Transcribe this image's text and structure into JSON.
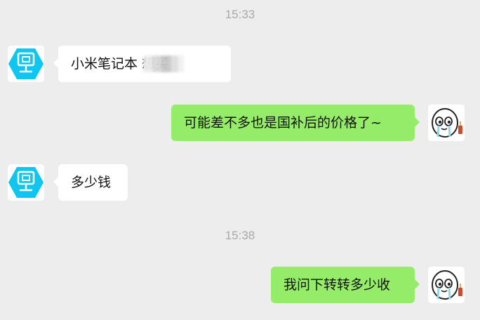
{
  "chat": {
    "timestamps": [
      "15:33",
      "15:38"
    ],
    "messages": [
      {
        "side": "left",
        "text": "小米笔记本      想买",
        "avatar": "monitor-hexagon-icon"
      },
      {
        "side": "right",
        "text": "可能差不多也是国补后的价格了~",
        "avatar": "cartoon-face-avatar"
      },
      {
        "side": "left",
        "text": "多少钱",
        "avatar": "monitor-hexagon-icon"
      },
      {
        "side": "right",
        "text": "我问下转转多少收",
        "avatar": "cartoon-face-avatar"
      }
    ]
  },
  "colors": {
    "background": "#ededed",
    "incoming_bubble": "#ffffff",
    "outgoing_bubble": "#95ec69",
    "timestamp_text": "#a9a9a9",
    "contact_icon": "#0fc6f0"
  }
}
